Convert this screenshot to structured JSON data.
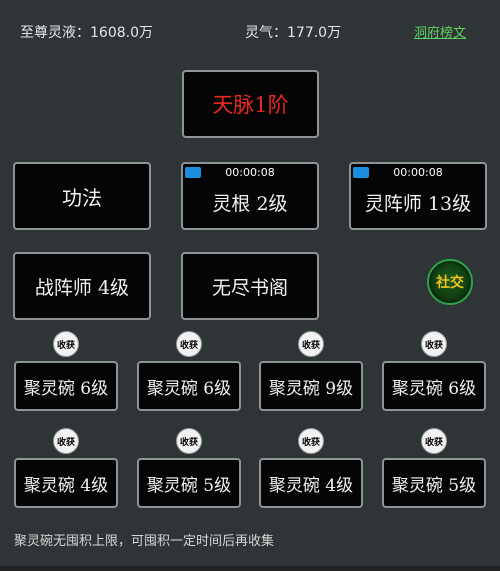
{
  "header": {
    "zhizun_lingye": "至尊灵液：1608.0万",
    "lingqi": "灵气：177.0万",
    "link": "洞府榜文"
  },
  "title_panel": {
    "label": "天脉1阶"
  },
  "skills": [
    {
      "label": "功法"
    },
    {
      "label": "灵根 2级",
      "timer": "00:00:08"
    },
    {
      "label": "灵阵师 13级",
      "timer": "00:00:08"
    },
    {
      "label": "战阵师 4级"
    },
    {
      "label": "无尽书阁"
    }
  ],
  "social": {
    "label": "社交"
  },
  "harvest_label": "收获",
  "bowls": [
    {
      "label": "聚灵碗 6级"
    },
    {
      "label": "聚灵碗 6级"
    },
    {
      "label": "聚灵碗 9级"
    },
    {
      "label": "聚灵碗 6级"
    },
    {
      "label": "聚灵碗 4级"
    },
    {
      "label": "聚灵碗 5级"
    },
    {
      "label": "聚灵碗 4级"
    },
    {
      "label": "聚灵碗 5级"
    }
  ],
  "footer": {
    "text": "聚灵碗无囤积上限，可囤积一定时间后再收集"
  },
  "colors": {
    "title_red": "#e8291f",
    "link_green": "#5fd35f",
    "timer_blue": "#1a8fe0",
    "social_gold": "#f0c419"
  }
}
